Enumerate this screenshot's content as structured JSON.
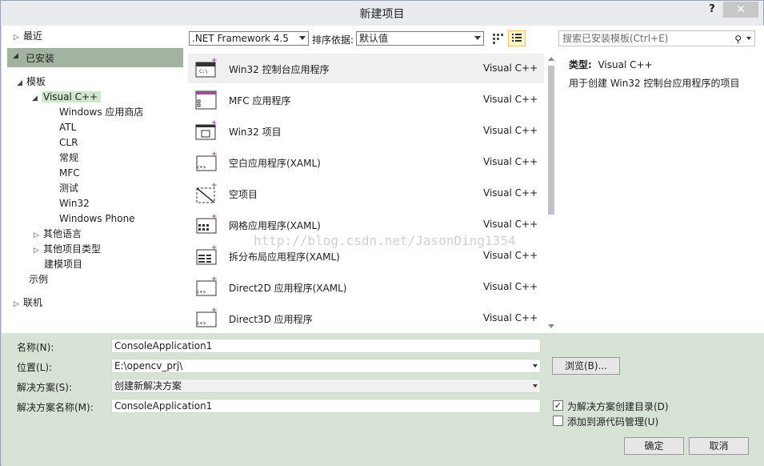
{
  "window": {
    "title": "新建项目",
    "help": "?",
    "close": "✕"
  },
  "sidebar": {
    "recent": "最近",
    "installed": "已安装",
    "templates": "模板",
    "visual_cpp": "Visual C++",
    "children": [
      "Windows 应用商店",
      "ATL",
      "CLR",
      "常规",
      "MFC",
      "测试",
      "Win32",
      "Windows Phone"
    ],
    "other_languages": "其他语言",
    "other_project_types": "其他项目类型",
    "modeling_projects": "建模项目",
    "samples": "示例",
    "online": "联机"
  },
  "toolbar": {
    "framework": ".NET Framework 4.5",
    "sort_label": "排序依据:",
    "sort_value": "默认值",
    "search_placeholder": "搜索已安装模板(Ctrl+E)"
  },
  "templates": [
    {
      "name": "Win32 控制台应用程序",
      "lang": "Visual C++",
      "icon": "console-app-icon"
    },
    {
      "name": "MFC 应用程序",
      "lang": "Visual C++",
      "icon": "mfc-app-icon"
    },
    {
      "name": "Win32 项目",
      "lang": "Visual C++",
      "icon": "win32-project-icon"
    },
    {
      "name": "空白应用程序(XAML)",
      "lang": "Visual C++",
      "icon": "blank-xaml-app-icon"
    },
    {
      "name": "空项目",
      "lang": "Visual C++",
      "icon": "empty-project-icon"
    },
    {
      "name": "网格应用程序(XAML)",
      "lang": "Visual C++",
      "icon": "grid-xaml-app-icon"
    },
    {
      "name": "拆分布局应用程序(XAML)",
      "lang": "Visual C++",
      "icon": "split-xaml-app-icon"
    },
    {
      "name": "Direct2D 应用程序(XAML)",
      "lang": "Visual C++",
      "icon": "direct2d-app-icon"
    },
    {
      "name": "Direct3D 应用程序",
      "lang": "Visual C++",
      "icon": "direct3d-app-icon"
    }
  ],
  "watermark": "http://blog.csdn.net/JasonDing1354",
  "details": {
    "type_label": "类型:",
    "type_value": "Visual C++",
    "description": "用于创建 Win32 控制台应用程序的项目"
  },
  "form": {
    "name_label": "名称(N):",
    "name_value": "ConsoleApplication1",
    "location_label": "位置(L):",
    "location_value": "E:\\opencv_prj\\",
    "solution_label": "解决方案(S):",
    "solution_value": "创建新解决方案",
    "solution_name_label": "解决方案名称(M):",
    "solution_name_value": "ConsoleApplication1",
    "browse": "浏览(B)...",
    "create_dir_label": "为解决方案创建目录(D)",
    "create_dir_checked": true,
    "add_scc_label": "添加到源代码管理(U)",
    "add_scc_checked": false,
    "ok": "确定",
    "cancel": "取消"
  },
  "colors": {
    "selected_green": "#a2b4a0",
    "form_bg": "#d6e3d5",
    "icon_purple": "#9b4f96"
  }
}
